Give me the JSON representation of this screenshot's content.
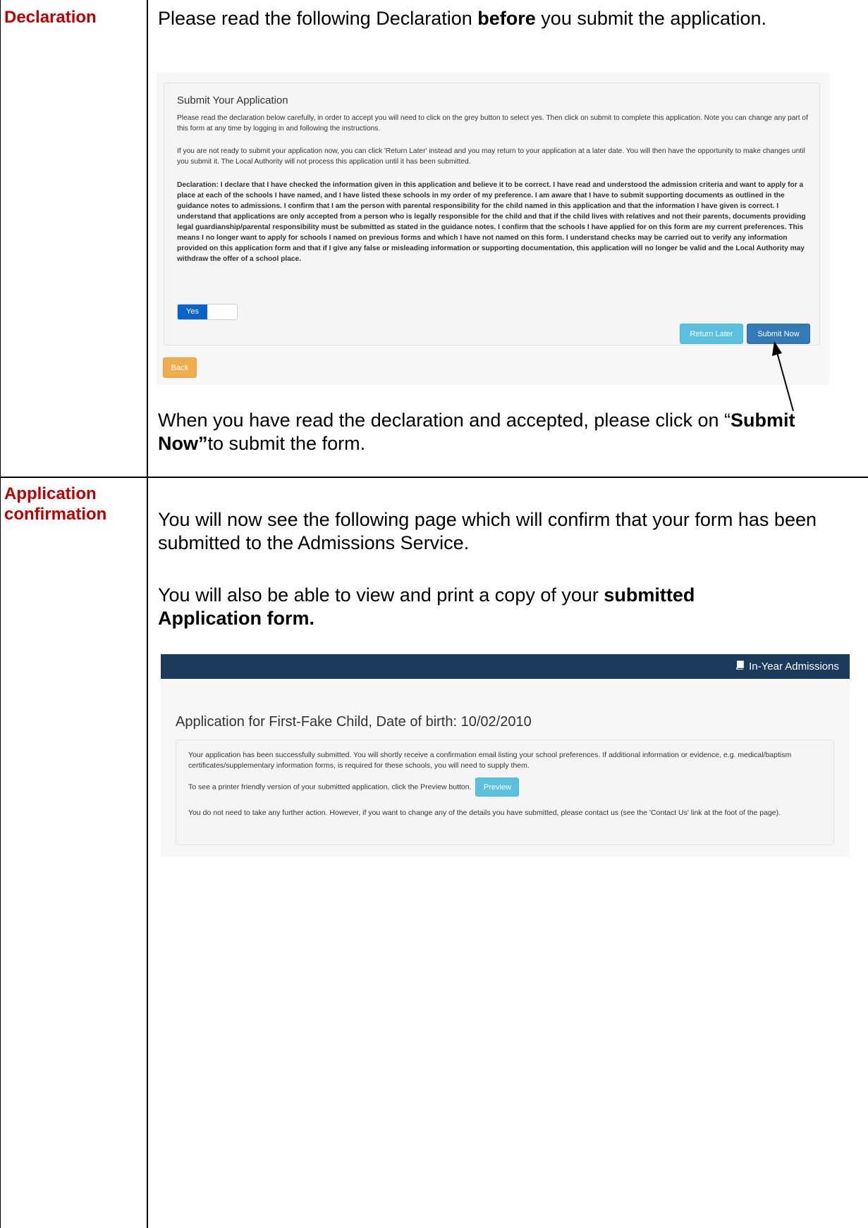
{
  "declaration_row": {
    "label": "Declaration",
    "intro_pre": "Please read the following Declaration ",
    "intro_bold": "before",
    "intro_post": " you submit the application.",
    "after_pre": "When you have read the declaration and accepted, please click on “",
    "after_bold": "Submit Now”",
    "after_post": "to submit the form."
  },
  "submit_screen": {
    "title": "Submit Your Application",
    "para1": "Please read the declaration below carefully, in order to accept you will need to click on the grey button to select yes. Then click on submit to complete this application. Note you can change any part of this form at any time by logging in and following the instructions.",
    "para2": "If you are not ready to submit your application now, you can click 'Return Later' instead and you may return to your application at a later date. You will then have the opportunity to make changes until you submit it. The Local Authority will not process this application until it has been submitted.",
    "declaration": "Declaration: I declare that I have checked the information given in this application and believe it to be correct. I have read and understood the admission criteria and want to apply for a place at each of the schools I have named, and I have listed these schools in my order of my preference. I am aware that I have to submit supporting documents as outlined in the guidance notes to admissions. I confirm that I am the person with parental responsibility for the child named in this application and that the information I have given is correct. I understand that applications are only accepted from a person who is legally responsible for the child and that if the child lives with relatives and not their parents, documents providing legal guardianship/parental responsibility must be submitted as stated in the guidance notes. I confirm that the schools I have applied for on this form are my current preferences. This means I no longer want to apply for schools I named on previous forms and which I have not named on this form. I understand checks may be carried out to verify any information provided on this application form and that if I give any false or misleading information or supporting documentation, this application will no longer be valid and the Local Authority may withdraw the offer of a school place.",
    "toggle_label": "Yes",
    "return_later_label": "Return Later",
    "submit_now_label": "Submit Now",
    "back_label": "Back"
  },
  "confirmation_row": {
    "label": "Application confirmation",
    "para1": "You will now see the following page which will confirm that your form has been submitted to the Admissions Service.",
    "para2_pre": "You will also be able to view and print a copy of your ",
    "para2_bold": "submitted Application form."
  },
  "confirmation_screen": {
    "nav_title": "In-Year Admissions",
    "nav_icon": "book-icon",
    "heading": "Application for First-Fake Child, Date of birth: 10/02/2010",
    "para1": "Your application has been successfully submitted. You will shortly receive a confirmation email listing your school preferences. If additional information or evidence, e.g. medical/baptism certificates/supplementary information forms, is required for these schools, you will need to supply them.",
    "para2": "To see a printer friendly version of your submitted application, click the Preview button.",
    "preview_label": "Preview",
    "para3": "You do not need to take any further action. However, if you want to change any of the details you have submitted, please contact us (see the 'Contact Us' link at the foot of the page)."
  }
}
